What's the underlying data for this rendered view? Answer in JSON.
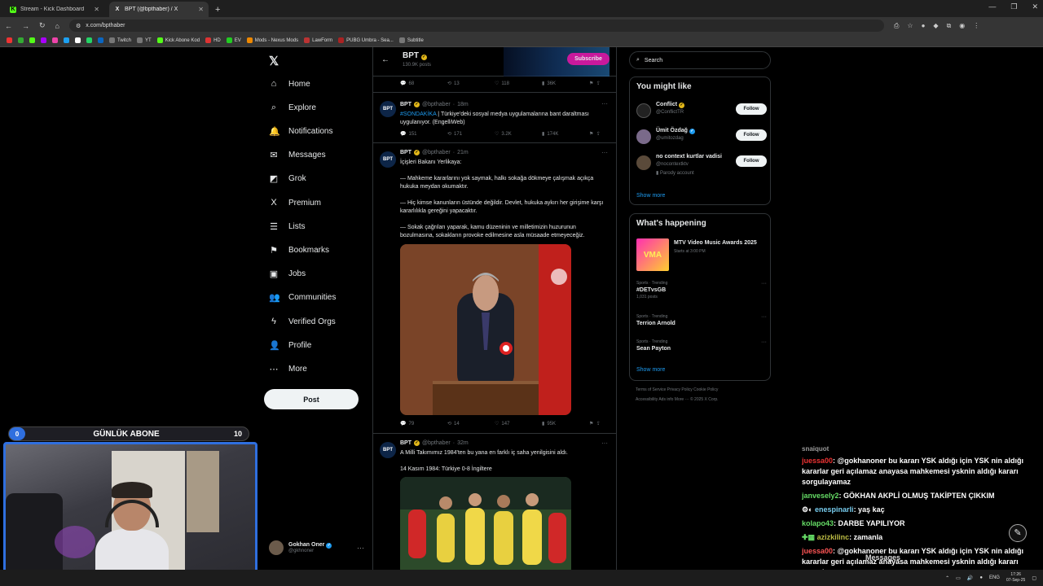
{
  "browser": {
    "tabs": [
      {
        "title": "Stream - Kick Dashboard",
        "favicon": "K",
        "color": "#53fc18"
      },
      {
        "title": "BPT (@bpthaber) / X",
        "favicon": "X",
        "color": "#ffffff"
      }
    ],
    "url": "x.com/bpthaber",
    "bookmarks": [
      "Twitch",
      "YT",
      "Kick Abone Kod",
      "HD",
      "EV",
      "Mods - Nexus Mods",
      "LawForm",
      "PUBG Umbra - Sea...",
      "Subtitle"
    ]
  },
  "nav": {
    "items": [
      {
        "label": "Home",
        "icon": "home-icon",
        "glyph": "⌂"
      },
      {
        "label": "Explore",
        "icon": "search-icon",
        "glyph": "⌕"
      },
      {
        "label": "Notifications",
        "icon": "bell-icon",
        "glyph": "🔔"
      },
      {
        "label": "Messages",
        "icon": "envelope-icon",
        "glyph": "✉"
      },
      {
        "label": "Grok",
        "icon": "grok-icon",
        "glyph": "◩"
      },
      {
        "label": "Premium",
        "icon": "x-premium-icon",
        "glyph": "X"
      },
      {
        "label": "Lists",
        "icon": "list-icon",
        "glyph": "☰"
      },
      {
        "label": "Bookmarks",
        "icon": "bookmark-icon",
        "glyph": "⚑"
      },
      {
        "label": "Jobs",
        "icon": "briefcase-icon",
        "glyph": "▣"
      },
      {
        "label": "Communities",
        "icon": "people-icon",
        "glyph": "👥"
      },
      {
        "label": "Verified Orgs",
        "icon": "lightning-icon",
        "glyph": "ϟ"
      },
      {
        "label": "Profile",
        "icon": "person-icon",
        "glyph": "👤"
      },
      {
        "label": "More",
        "icon": "more-circle-icon",
        "glyph": "⋯"
      }
    ],
    "post_label": "Post",
    "account": {
      "name": "Gokhan Oner",
      "handle": "@gkhnoner"
    }
  },
  "profile_header": {
    "name": "BPT",
    "posts": "130.9K posts",
    "subscribe_label": "Subscribe"
  },
  "tweets": [
    {
      "stats": {
        "replies": "68",
        "reposts": "13",
        "likes": "118",
        "views": "36K"
      }
    },
    {
      "name": "BPT",
      "handle": "@bpthaber",
      "time": "18m",
      "tag": "#SONDAKİKA",
      "text": " | Türkiye'deki sosyal medya uygulamalarına bant daraltması uygulanıyor. (EngelliWeb)",
      "stats": {
        "replies": "151",
        "reposts": "171",
        "likes": "3.2K",
        "views": "174K"
      }
    },
    {
      "name": "BPT",
      "handle": "@bpthaber",
      "time": "21m",
      "paragraphs": [
        "İçişleri Bakanı Yerlikaya:",
        "— Mahkeme kararlarını yok saymak, halkı sokağa dökmeye çalışmak açıkça hukuka meydan okumaktır.",
        "— Hiç kimse kanunların üstünde değildir. Devlet, hukuka aykırı her girişime karşı kararlılıkla gereğini yapacaktır.",
        "— Sokak çağrıları yaparak, kamu düzeninin ve milletimizin huzurunun bozulmasına, sokakların provoke edilmesine asla müsaade etmeyeceğiz."
      ],
      "stats": {
        "replies": "79",
        "reposts": "14",
        "likes": "147",
        "views": "95K"
      }
    },
    {
      "name": "BPT",
      "handle": "@bpthaber",
      "time": "32m",
      "paragraphs": [
        "A Milli Takımımız 1984'ten bu yana en farklı iç saha yenilgisini aldı.",
        "14 Kasım 1984: Türkiye 0-8 İngiltere"
      ]
    }
  ],
  "right": {
    "search_placeholder": "Search",
    "might_like_title": "You might like",
    "suggestions": [
      {
        "name": "Conflict",
        "handle": "@ConflictTR",
        "extra": "",
        "follow": "Follow"
      },
      {
        "name": "Ümit Özdağ",
        "handle": "@umitozdag",
        "extra": "",
        "follow": "Follow"
      },
      {
        "name": "no context kurtlar vadisi",
        "handle": "@nocontextktv",
        "extra": "Parody account",
        "follow": "Follow"
      }
    ],
    "show_more": "Show more",
    "happening_title": "What's happening",
    "event": {
      "title": "MTV Video Music Awards 2025",
      "sub": "Starts at 3:00 PM",
      "logo": "VMA"
    },
    "trends": [
      {
        "ctx": "Sports · Trending",
        "title": "#DETvsGB",
        "count": "1,031 posts"
      },
      {
        "ctx": "Sports · Trending",
        "title": "Terrion Arnold",
        "count": ""
      },
      {
        "ctx": "Sports · Trending",
        "title": "Sean Payton",
        "count": ""
      }
    ],
    "footer1": "Terms of Service   Privacy Policy   Cookie Policy",
    "footer2": "Accessibility   Ads info   More ···   © 2025 X Corp."
  },
  "overlay": {
    "abone_label": "GÜNLÜK ABONE",
    "abone_current": "0",
    "abone_goal": "10",
    "chat": [
      {
        "user": "juessa00",
        "msg": ": @gokhanoner bu kararı YSK aldığı için YSK nin aldığı kararlar geri açılamaz anayasa mahkemesi ysknin aldığı kararı sorgulayamaz"
      },
      {
        "user": "janvesely2",
        "msg": ": GÖKHAN AKPLİ OLMUŞ TAKİPTEN ÇIKKIM"
      },
      {
        "user": "enespinarli",
        "msg": ": yaş kaç"
      },
      {
        "user": "kolapo43",
        "msg": ": DARBE YAPILIYOR"
      },
      {
        "user": "azizkilinc",
        "msg": ": zamanla"
      },
      {
        "user": "juessa00",
        "msg": ": @gokhanoner bu kararı YSK aldığı için YSK nin aldığı kararlar geri açılamaz anayasa mahkemesi ysknin aldığı kararı sorgulayamaz"
      }
    ],
    "chat_top_user": "snaiquot",
    "messages_label": "Messages"
  },
  "taskbar": {
    "lang": "ENG",
    "time": "17:26",
    "date": "07-Sep-25"
  }
}
